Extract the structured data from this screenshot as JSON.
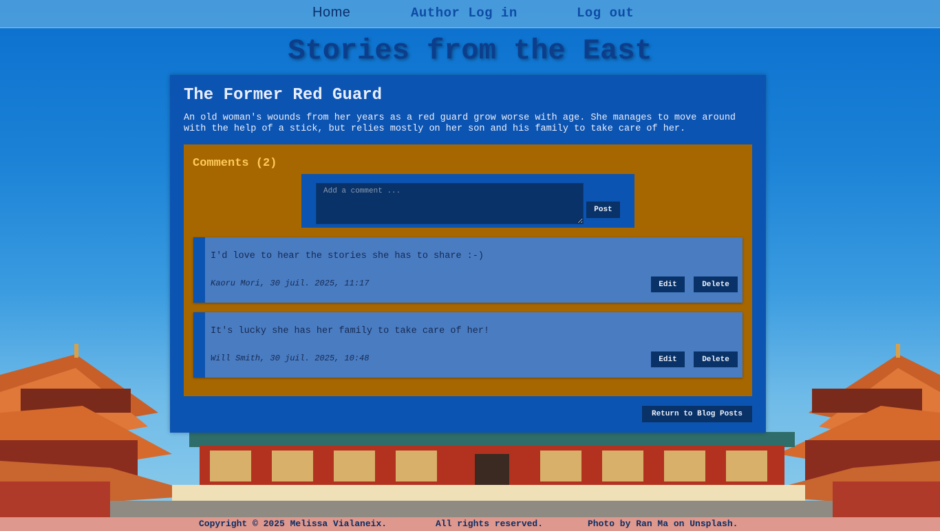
{
  "nav": {
    "home": "Home",
    "author_login": "Author Log in",
    "logout": "Log out"
  },
  "site_title": "Stories from the East",
  "post": {
    "title": "The Former Red Guard",
    "body": "An old woman's wounds from her years as a red guard grow worse with age. She manages to move around with the help of a stick, but relies mostly on her son and his family to take care of her."
  },
  "comments": {
    "heading": "Comments (2)",
    "input_placeholder": "Add a comment ...",
    "post_label": "Post",
    "items": [
      {
        "text": "I'd love to hear the stories she has to share :-)",
        "meta": "Kaoru Mori, 30 juil. 2025, 11:17",
        "edit_label": "Edit",
        "delete_label": "Delete"
      },
      {
        "text": "It's lucky she has her family to take care of her!",
        "meta": "Will Smith, 30 juil. 2025, 10:48",
        "edit_label": "Edit",
        "delete_label": "Delete"
      }
    ]
  },
  "return_label": "Return to Blog Posts",
  "footer": {
    "copyright": "Copyright © 2025 Melissa Vialaneix.",
    "rights": "All rights reserved.",
    "photo_credit": "Photo by Ran Ma on Unsplash."
  },
  "colors": {
    "card": "#0c54b2",
    "comments_panel": "#a66600",
    "comment_item": "#4a7cc2",
    "button": "#083268",
    "heading_accent": "#ffca5a"
  }
}
